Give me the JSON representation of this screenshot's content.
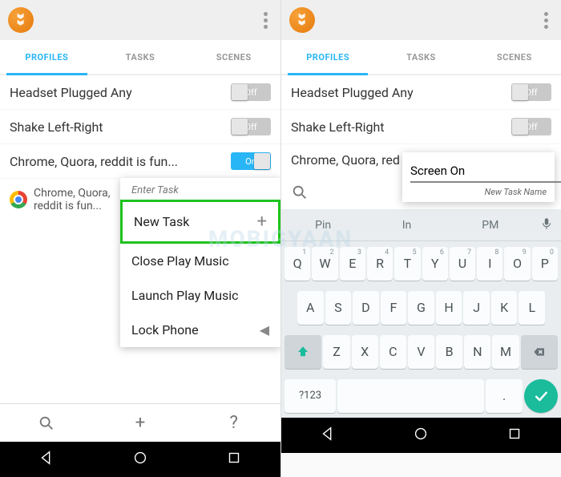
{
  "left": {
    "tabs": {
      "profiles": "PROFILES",
      "tasks": "TASKS",
      "scenes": "SCENES"
    },
    "rows": [
      {
        "label": "Headset Plugged Any",
        "state": "Off"
      },
      {
        "label": "Shake Left-Right",
        "state": "Off"
      },
      {
        "label": "Chrome, Quora, reddit is fun...",
        "state": "On"
      }
    ],
    "subrow": "Chrome, Quora, reddit is fun...",
    "menu": {
      "header": "Enter Task",
      "items": [
        {
          "label": "New Task",
          "add": true,
          "highlight": true
        },
        {
          "label": "Close Play Music"
        },
        {
          "label": "Launch Play Music"
        },
        {
          "label": "Lock Phone",
          "chevron": true
        }
      ]
    },
    "bottombar": {
      "search": "🔍",
      "add": "+",
      "help": "?"
    }
  },
  "right": {
    "tabs": {
      "profiles": "PROFILES",
      "tasks": "TASKS",
      "scenes": "SCENES"
    },
    "rows": [
      {
        "label": "Headset Plugged Any",
        "state": "Off"
      },
      {
        "label": "Shake Left-Right",
        "state": "Off"
      },
      {
        "label": "Chrome, Quora, red",
        "state": ""
      }
    ],
    "name_popup": {
      "value": "Screen On",
      "hint": "New Task Name"
    },
    "keyboard": {
      "predict": [
        "Pin",
        "In",
        "PM"
      ],
      "row1": [
        [
          "Q",
          "1"
        ],
        [
          "W",
          "2"
        ],
        [
          "E",
          "3"
        ],
        [
          "R",
          "4"
        ],
        [
          "T",
          "5"
        ],
        [
          "Y",
          "6"
        ],
        [
          "U",
          "7"
        ],
        [
          "I",
          "8"
        ],
        [
          "O",
          "9"
        ],
        [
          "P",
          "0"
        ]
      ],
      "row2": [
        "A",
        "S",
        "D",
        "F",
        "G",
        "H",
        "J",
        "K",
        "L"
      ],
      "row3": [
        "Z",
        "X",
        "C",
        "V",
        "B",
        "N",
        "M"
      ],
      "sym": "?123",
      "period": "."
    }
  },
  "watermark": "MOBIGYAAN"
}
